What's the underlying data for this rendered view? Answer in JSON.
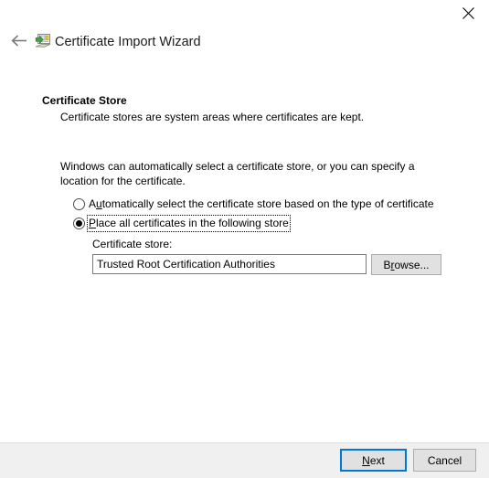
{
  "window": {
    "title": "Certificate Import Wizard",
    "icon": "certificate-import-icon",
    "close_label": "×",
    "back_label": "←"
  },
  "page": {
    "heading": "Certificate Store",
    "subheading": "Certificate stores are system areas where certificates are kept.",
    "intro": "Windows can automatically select a certificate store, or you can specify a location for the certificate."
  },
  "options": {
    "auto": {
      "label_prefix": "A",
      "label_accel": "u",
      "label_suffix": "tomatically select the certificate store based on the type of certificate",
      "full_label": "Automatically select the certificate store based on the type of certificate",
      "selected": false,
      "focused": false
    },
    "place": {
      "label_prefix": "",
      "label_accel": "P",
      "label_suffix": "lace all certificates in the following store",
      "full_label": "Place all certificates in the following store",
      "selected": true,
      "focused": true
    }
  },
  "store": {
    "label": "Certificate store:",
    "value": "Trusted Root Certification Authorities",
    "placeholder": "",
    "browse_prefix": "B",
    "browse_accel": "r",
    "browse_suffix": "owse...",
    "browse_label": "Browse..."
  },
  "footer": {
    "next_prefix": "",
    "next_accel": "N",
    "next_suffix": "ext",
    "next_label": "Next",
    "cancel_label": "Cancel"
  },
  "colors": {
    "accent": "#0078d7",
    "footer_bg": "#f0f0f0",
    "button_bg": "#e1e1e1",
    "button_border": "#acacac"
  }
}
